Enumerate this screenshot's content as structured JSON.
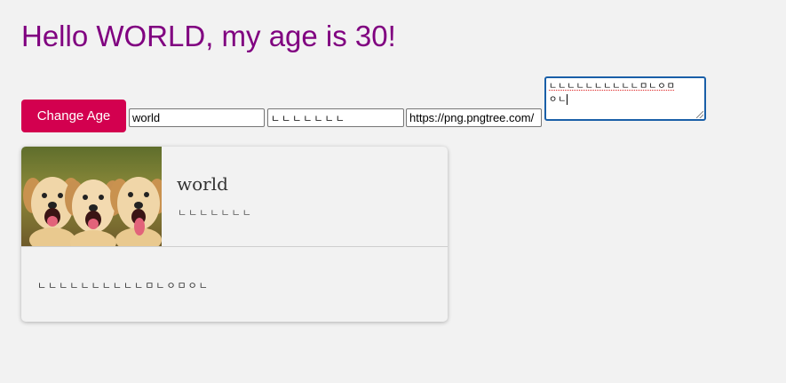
{
  "heading": "Hello WORLD, my age is 30!",
  "controls": {
    "change_age_label": "Change Age",
    "name_value": "world",
    "description_value": "ㄴㄴㄴㄴㄴㄴㄴ",
    "image_url_value": "https://png.pngtree.com/",
    "textarea_line1": "ㄴㄴㄴㄴㄴㄴㄴㄴㄴㄴㅁㄴㅇㅁ",
    "textarea_line2": "ㅇㄴ"
  },
  "card": {
    "title": "world",
    "subtitle": "ㄴㄴㄴㄴㄴㄴㄴ",
    "body": "ㄴㄴㄴㄴㄴㄴㄴㄴㄴㄴㅁㄴㅇㅁㅇㄴ",
    "image_subject": "three-puppies"
  },
  "colors": {
    "heading": "#800080",
    "button": "#d3004f",
    "focus_border": "#1a5fa8",
    "background": "#f2f2f2"
  }
}
